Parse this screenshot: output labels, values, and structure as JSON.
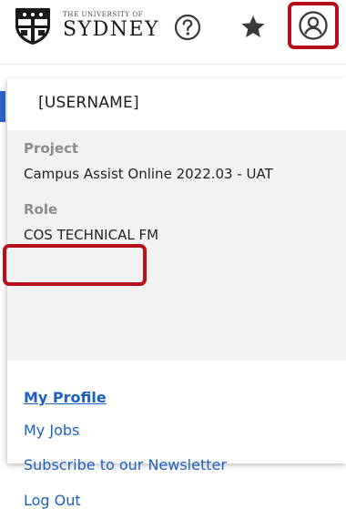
{
  "header": {
    "logo": {
      "line1": "THE UNIVERSITY OF",
      "line2": "SYDNEY"
    },
    "icons": {
      "help": "help-circle-icon",
      "favorites": "star-icon",
      "account": "user-circle-icon"
    },
    "highlight_color": "#b5111c"
  },
  "dropdown": {
    "username": "[USERNAME]",
    "project_label": "Project",
    "project_value": "Campus Assist Online 2022.03 - UAT",
    "role_label": "Role",
    "role_value": "COS TECHNICAL FM",
    "menu": [
      {
        "label": "My Profile",
        "active": true
      },
      {
        "label": "My Jobs",
        "active": false
      },
      {
        "label": "Subscribe to our Newsletter",
        "active": false
      },
      {
        "label": "Log Out",
        "active": false
      }
    ]
  },
  "colors": {
    "link": "#1d5fbf",
    "muted_label": "#8c8c8c",
    "info_background": "#f2f2f2"
  }
}
